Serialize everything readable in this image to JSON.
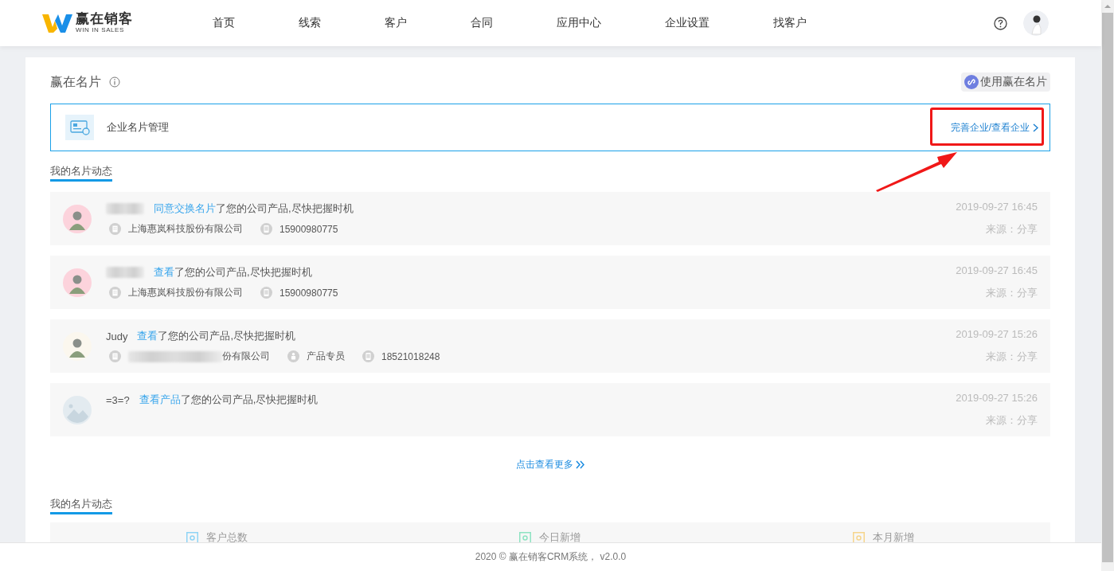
{
  "header": {
    "logo": {
      "title": "赢在销客",
      "subtitle": "WIN IN SALES"
    },
    "nav": [
      {
        "label": "首页",
        "selected": false
      },
      {
        "label": "线索",
        "selected": false
      },
      {
        "label": "客户",
        "selected": false
      },
      {
        "label": "合同",
        "selected": false
      },
      {
        "label": "应用中心",
        "selected": false
      },
      {
        "label": "企业设置",
        "selected": false
      },
      {
        "label": "找客户",
        "selected": false
      }
    ]
  },
  "page": {
    "title": "赢在名片",
    "use_button": "使用赢在名片",
    "company_card": {
      "label": "企业名片管理",
      "link": "完善企业/查看企业"
    }
  },
  "activity": {
    "title": "我的名片动态",
    "items": [
      {
        "avatar": {
          "kind": "photo",
          "color": "#fcd3dc"
        },
        "action": "同意交换名片",
        "message": "了您的公司产品,尽快把握时机",
        "details": [
          {
            "kind": "company",
            "text": "上海惠岚科技股份有限公司"
          },
          {
            "kind": "phone",
            "text": "15900980775"
          }
        ],
        "time": "2019-09-27 16:45",
        "source": "来源：分享"
      },
      {
        "avatar": {
          "kind": "photo",
          "color": "#fcd3dc"
        },
        "action": "查看",
        "message": "了您的公司产品,尽快把握时机",
        "details": [
          {
            "kind": "company",
            "text": "上海惠岚科技股份有限公司"
          },
          {
            "kind": "phone",
            "text": "15900980775"
          }
        ],
        "time": "2019-09-27 16:45",
        "source": "来源：分享"
      },
      {
        "avatar": {
          "kind": "photo",
          "color": "#fbf7ee"
        },
        "name": "Judy",
        "action": "查看",
        "message": "了您的公司产品,尽快把握时机",
        "details": [
          {
            "kind": "company",
            "text": "份有限公司",
            "redacted": true
          },
          {
            "kind": "position",
            "text": "产品专员"
          },
          {
            "kind": "phone",
            "text": "18521018248"
          }
        ],
        "time": "2019-09-27 15:26",
        "source": "来源：分享"
      },
      {
        "avatar": {
          "kind": "placeholder",
          "color": "#e3ebf0"
        },
        "name": "=3=?",
        "action": "查看产品",
        "message": "了您的公司产品,尽快把握时机",
        "time": "2019-09-27 15:26",
        "source": "来源：分享"
      }
    ],
    "more": "点击查看更多"
  },
  "stats": {
    "title": "我的名片动态",
    "items": [
      {
        "label": "客户总数",
        "color": "#8fd4f5"
      },
      {
        "label": "今日新增",
        "color": "#8ee3c2"
      },
      {
        "label": "本月新增",
        "color": "#f6d58c"
      }
    ]
  },
  "footer": "2020 © 赢在销客CRM系统， v2.0.0"
}
